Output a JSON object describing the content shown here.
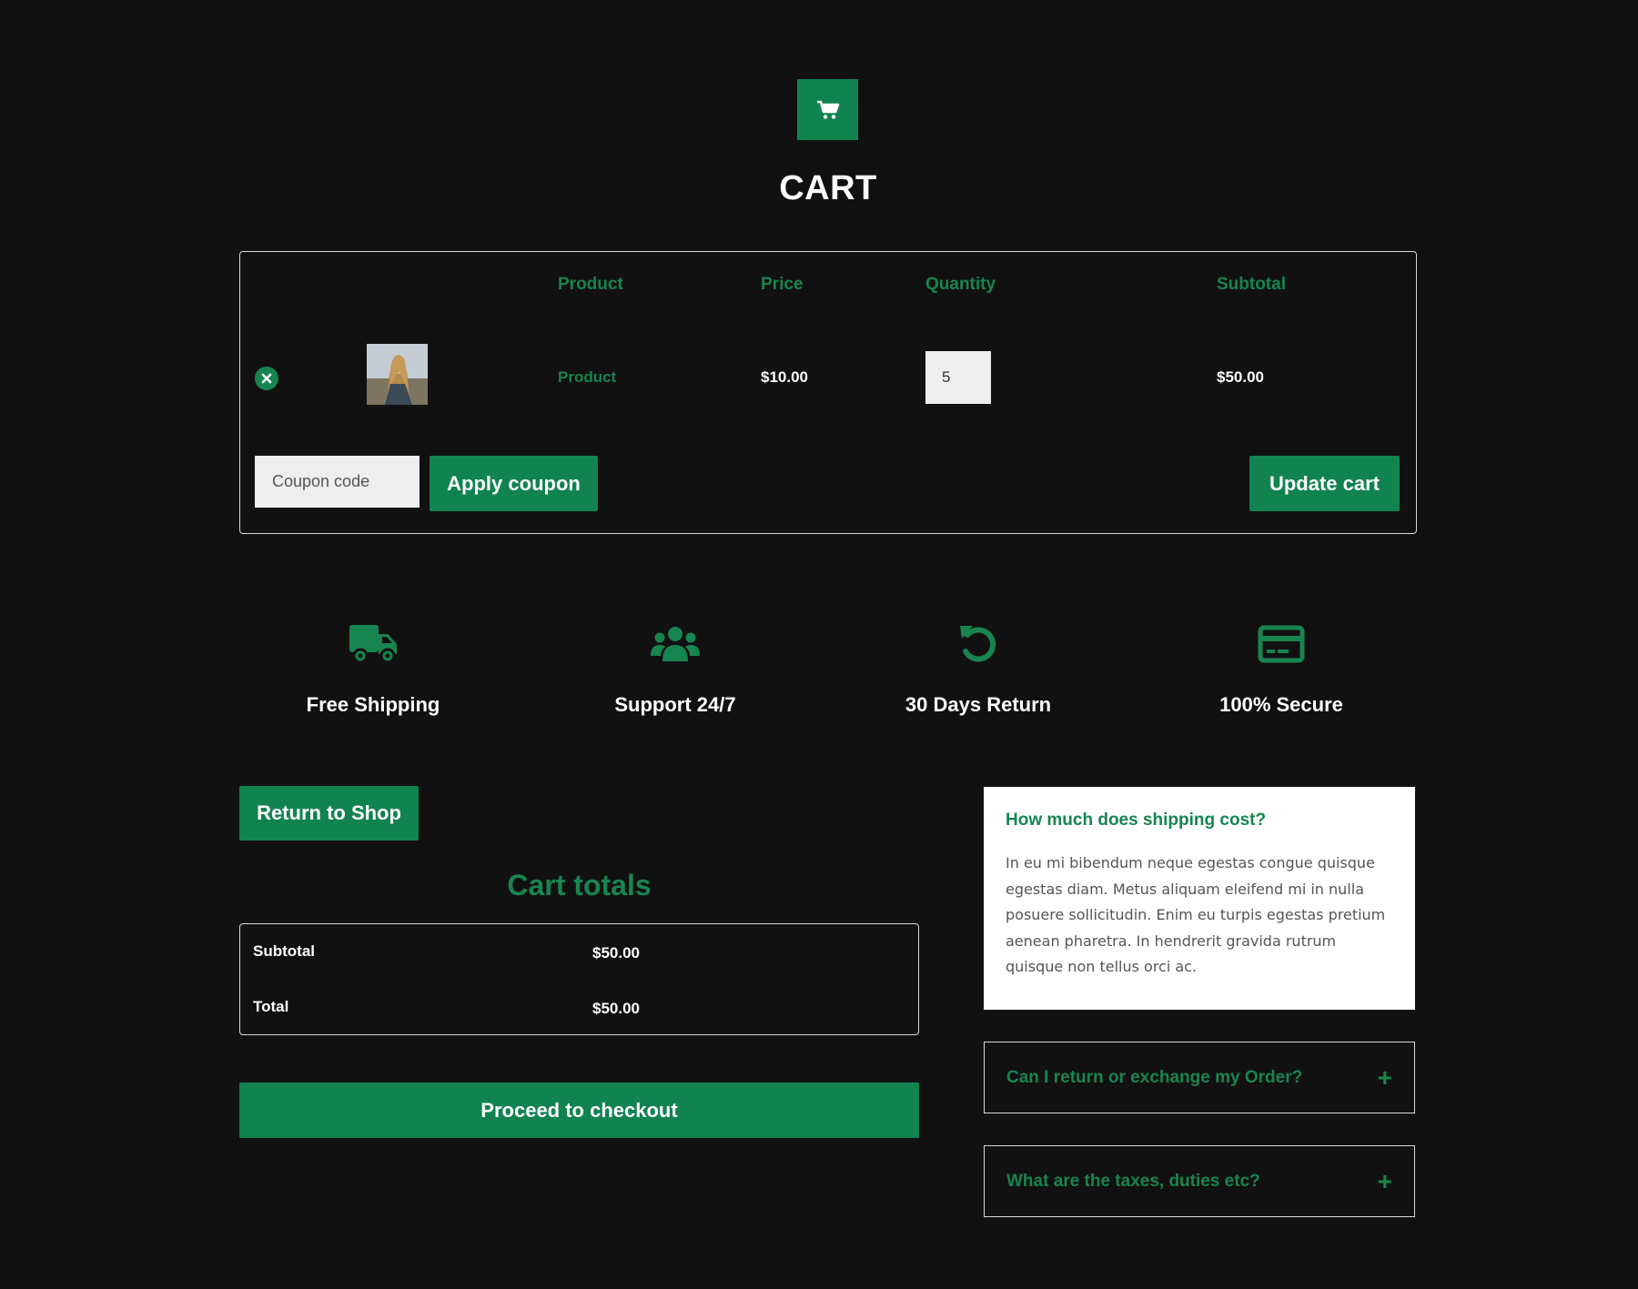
{
  "header": {
    "icon": "shopping-cart-icon",
    "title": "CART"
  },
  "cart": {
    "columns": [
      "Product",
      "Price",
      "Quantity",
      "Subtotal"
    ],
    "rows": [
      {
        "product": "Product",
        "price": "$10.00",
        "quantity": "5",
        "subtotal": "$50.00"
      }
    ],
    "coupon_placeholder": "Coupon code",
    "apply_label": "Apply coupon",
    "update_label": "Update cart"
  },
  "features": [
    {
      "icon": "truck-icon",
      "label": "Free Shipping"
    },
    {
      "icon": "users-icon",
      "label": "Support 24/7"
    },
    {
      "icon": "undo-icon",
      "label": "30 Days Return"
    },
    {
      "icon": "credit-card-icon",
      "label": "100% Secure"
    }
  ],
  "actions": {
    "return_label": "Return to Shop",
    "checkout_label": "Proceed to checkout"
  },
  "totals": {
    "title": "Cart totals",
    "subtotal_label": "Subtotal",
    "subtotal_value": "$50.00",
    "total_label": "Total",
    "total_value": "$50.00"
  },
  "faq": [
    {
      "question": "How much does shipping cost?",
      "answer": "In eu mi bibendum neque egestas congue quisque egestas diam. Metus aliquam eleifend mi in nulla posuere sollicitudin. Enim eu turpis egestas pretium aenean pharetra. In hendrerit gravida rutrum quisque non tellus orci ac.",
      "expanded": true
    },
    {
      "question": "Can I return or exchange my Order?",
      "expanded": false
    },
    {
      "question": "What are the taxes, duties etc?",
      "expanded": false
    }
  ],
  "colors": {
    "background": "#111112",
    "accent": "#11834f",
    "text": "#ffffff",
    "border": "#d9d9d9"
  }
}
